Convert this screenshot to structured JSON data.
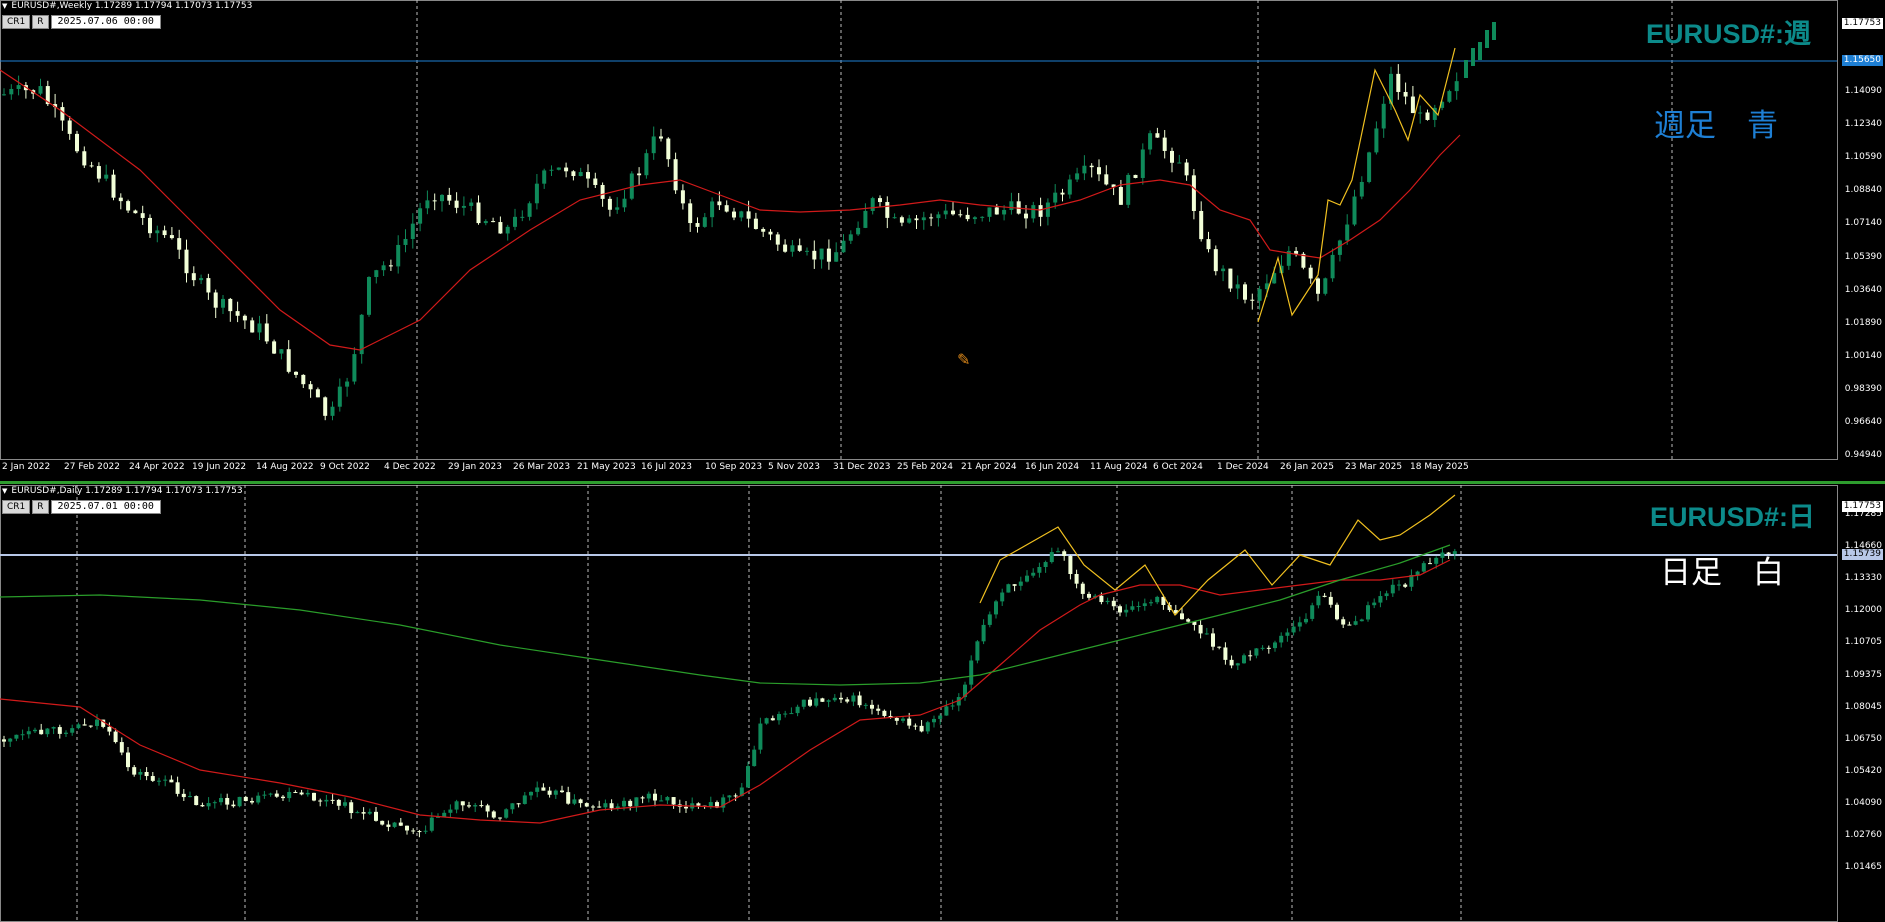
{
  "colors": {
    "background": "#000000",
    "bull_candle": "#0f8a5a",
    "bear_candle": "#f2ffd8",
    "ma_red": "#d11a1a",
    "ma_green": "#2a9d2a",
    "zigzag": "#f0c020",
    "hline_weekly": "#1e7fd4",
    "hline_daily": "#b8c8e8",
    "symbol_label": "#0c8a8a",
    "note_weekly": "#1e7fd4",
    "note_daily": "#ffffff"
  },
  "weekly": {
    "header": "EURUSD#,Weekly  1.17289 1.17794 1.17073 1.17753",
    "btn_cr": "CR1",
    "btn_r": "R",
    "date_field": "2025.07.06 00:00",
    "symbol_label": "EURUSD#:週",
    "note": "週足　青",
    "hline_price": "1.15650",
    "current_price": "1.17753",
    "price_axis": [
      "1.14090",
      "1.12340",
      "1.10590",
      "1.08840",
      "1.07140",
      "1.05390",
      "1.03640",
      "1.01890",
      "1.00140",
      "0.98390",
      "0.96640",
      "0.94940"
    ],
    "time_axis": [
      "2 Jan 2022",
      "27 Feb 2022",
      "24 Apr 2022",
      "19 Jun 2022",
      "14 Aug 2022",
      "9 Oct 2022",
      "4 Dec 2022",
      "29 Jan 2023",
      "26 Mar 2023",
      "21 May 2023",
      "16 Jul 2023",
      "10 Sep 2023",
      "5 Nov 2023",
      "31 Dec 2023",
      "25 Feb 2024",
      "21 Apr 2024",
      "16 Jun 2024",
      "11 Aug 2024",
      "6 Oct 2024",
      "1 Dec 2024",
      "26 Jan 2025",
      "23 Mar 2025",
      "18 May 2025"
    ],
    "cursor_icon": "crosshair-pencil-icon"
  },
  "daily": {
    "header": "EURUSD#,Daily  1.17289 1.17794 1.17073 1.17753",
    "btn_cr": "CR1",
    "btn_r": "R",
    "date_field": "2025.07.01 00:00",
    "symbol_label": "EURUSD#:日",
    "note": "日足　白",
    "hline_price": "1.15739",
    "current_price": "1.17753",
    "price_axis": [
      "1.17285",
      "1.14660",
      "1.13330",
      "1.12000",
      "1.10705",
      "1.09375",
      "1.08045",
      "1.06750",
      "1.05420",
      "1.04090",
      "1.02760",
      "1.01465"
    ]
  }
}
